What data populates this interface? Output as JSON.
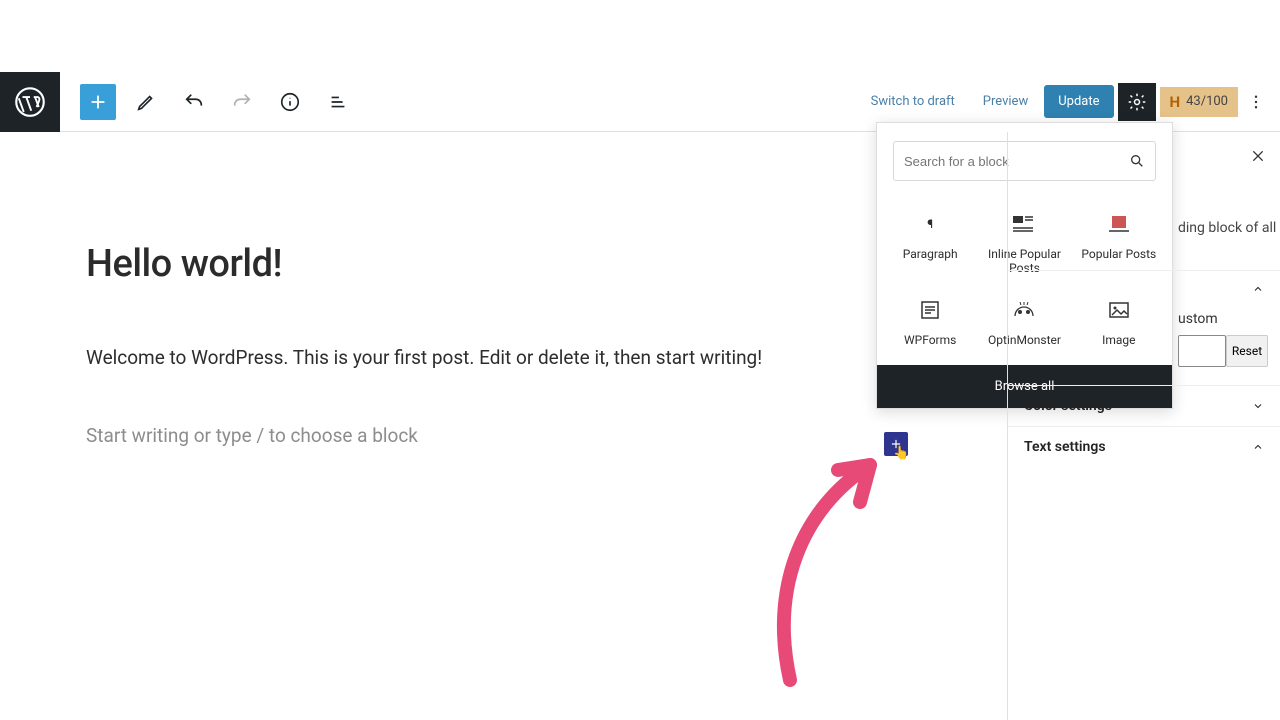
{
  "toolbar": {
    "switch_to_draft": "Switch to draft",
    "preview": "Preview",
    "update": "Update",
    "seo_score": "43/100"
  },
  "post": {
    "title": "Hello world!",
    "body": "Welcome to WordPress. This is your first post. Edit or delete it, then start writing!",
    "placeholder": "Start writing or type / to choose a block"
  },
  "inserter": {
    "search_placeholder": "Search for a block",
    "blocks": [
      {
        "label": "Paragraph"
      },
      {
        "label": "Inline Popular Posts"
      },
      {
        "label": "Popular Posts"
      },
      {
        "label": "WPForms"
      },
      {
        "label": "OptinMonster"
      },
      {
        "label": "Image"
      }
    ],
    "browse_all": "Browse all"
  },
  "sidebar": {
    "snippet": "ding block of all",
    "panels": {
      "option_label": "ustom",
      "reset": "Reset",
      "color": "Color settings",
      "text": "Text settings"
    }
  }
}
